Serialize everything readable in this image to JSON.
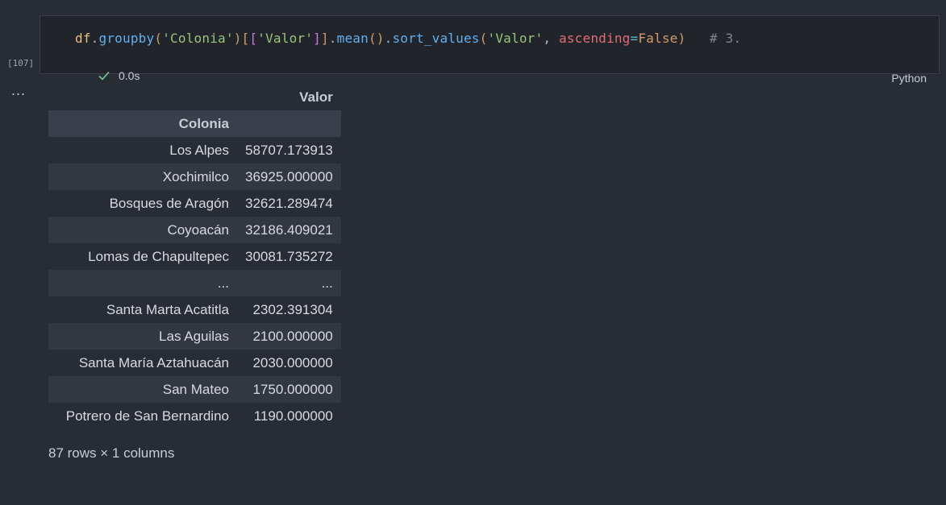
{
  "cell": {
    "execution_count": "[107]",
    "status_time": "0.0s",
    "kernel_language": "Python",
    "code_tokens": [
      {
        "t": "df",
        "c": "tk-var"
      },
      {
        "t": ".",
        "c": "tk-punc"
      },
      {
        "t": "groupby",
        "c": "tk-fn"
      },
      {
        "t": "(",
        "c": "tk-br1"
      },
      {
        "t": "'Colonia'",
        "c": "tk-str"
      },
      {
        "t": ")",
        "c": "tk-br1"
      },
      {
        "t": "[",
        "c": "tk-br1"
      },
      {
        "t": "[",
        "c": "tk-br2"
      },
      {
        "t": "'Valor'",
        "c": "tk-str"
      },
      {
        "t": "]",
        "c": "tk-br2"
      },
      {
        "t": "]",
        "c": "tk-br1"
      },
      {
        "t": ".",
        "c": "tk-punc"
      },
      {
        "t": "mean",
        "c": "tk-fn"
      },
      {
        "t": "()",
        "c": "tk-br1"
      },
      {
        "t": ".",
        "c": "tk-punc"
      },
      {
        "t": "sort_values",
        "c": "tk-fn"
      },
      {
        "t": "(",
        "c": "tk-br1"
      },
      {
        "t": "'Valor'",
        "c": "tk-str"
      },
      {
        "t": ", ",
        "c": "tk-punc"
      },
      {
        "t": "ascending",
        "c": "tk-kw"
      },
      {
        "t": "=",
        "c": "tk-op"
      },
      {
        "t": "False",
        "c": "tk-const"
      },
      {
        "t": ")",
        "c": "tk-br1"
      },
      {
        "t": "   # 3.",
        "c": "tk-comment"
      }
    ]
  },
  "output": {
    "dots": "...",
    "table": {
      "column_header": "Valor",
      "index_name": "Colonia",
      "rows": [
        {
          "index": "Los Alpes",
          "value": "58707.173913"
        },
        {
          "index": "Xochimilco",
          "value": "36925.000000"
        },
        {
          "index": "Bosques de Aragón",
          "value": "32621.289474"
        },
        {
          "index": "Coyoacán",
          "value": "32186.409021"
        },
        {
          "index": "Lomas de Chapultepec",
          "value": "30081.735272"
        },
        {
          "index": "...",
          "value": "..."
        },
        {
          "index": "Santa Marta Acatitla",
          "value": "2302.391304"
        },
        {
          "index": "Las Aguilas",
          "value": "2100.000000"
        },
        {
          "index": "Santa María Aztahuacán",
          "value": "2030.000000"
        },
        {
          "index": "San Mateo",
          "value": "1750.000000"
        },
        {
          "index": "Potrero de San Bernardino",
          "value": "1190.000000"
        }
      ]
    },
    "summary": "87 rows × 1 columns"
  },
  "colors": {
    "background": "#282c34",
    "cell_background": "#21252b",
    "header_background": "#3a3f4b",
    "row_alt_background": "#323742",
    "success_check": "#73c991"
  }
}
